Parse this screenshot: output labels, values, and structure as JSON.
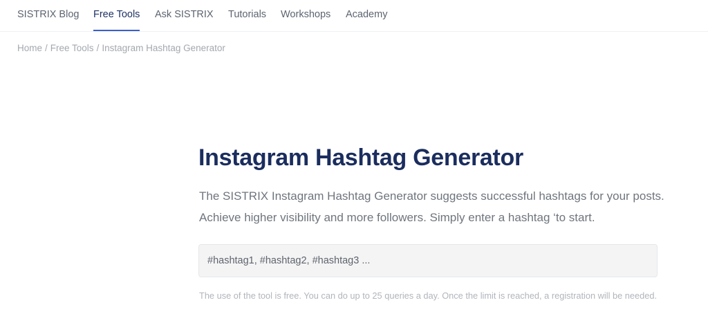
{
  "nav": {
    "items": [
      {
        "label": "SISTRIX Blog"
      },
      {
        "label": "Free Tools",
        "active": true
      },
      {
        "label": "Ask SISTRIX"
      },
      {
        "label": "Tutorials"
      },
      {
        "label": "Workshops"
      },
      {
        "label": "Academy"
      }
    ]
  },
  "breadcrumb": {
    "items": [
      "Home",
      "Free Tools",
      "Instagram Hashtag Generator"
    ],
    "separator": "/"
  },
  "main": {
    "title": "Instagram Hashtag Generator",
    "intro": "The SISTRIX Instagram Hashtag Generator suggests successful hashtags for your posts. Achieve higher visibility and more followers. Simply enter a hashtag ‘to start.",
    "search": {
      "value": "",
      "placeholder": "#hashtag1, #hashtag2, #hashtag3 ..."
    },
    "note": "The use of the tool is free. You can do up to 25 queries a day. Once the limit is reached, a registration will be needed."
  },
  "colors": {
    "title": "#1b2d5e",
    "active_nav": "#1e3163",
    "accent_underline": "#3b5fc9",
    "body_text": "#6f757d",
    "muted_text": "#a3a8af"
  }
}
